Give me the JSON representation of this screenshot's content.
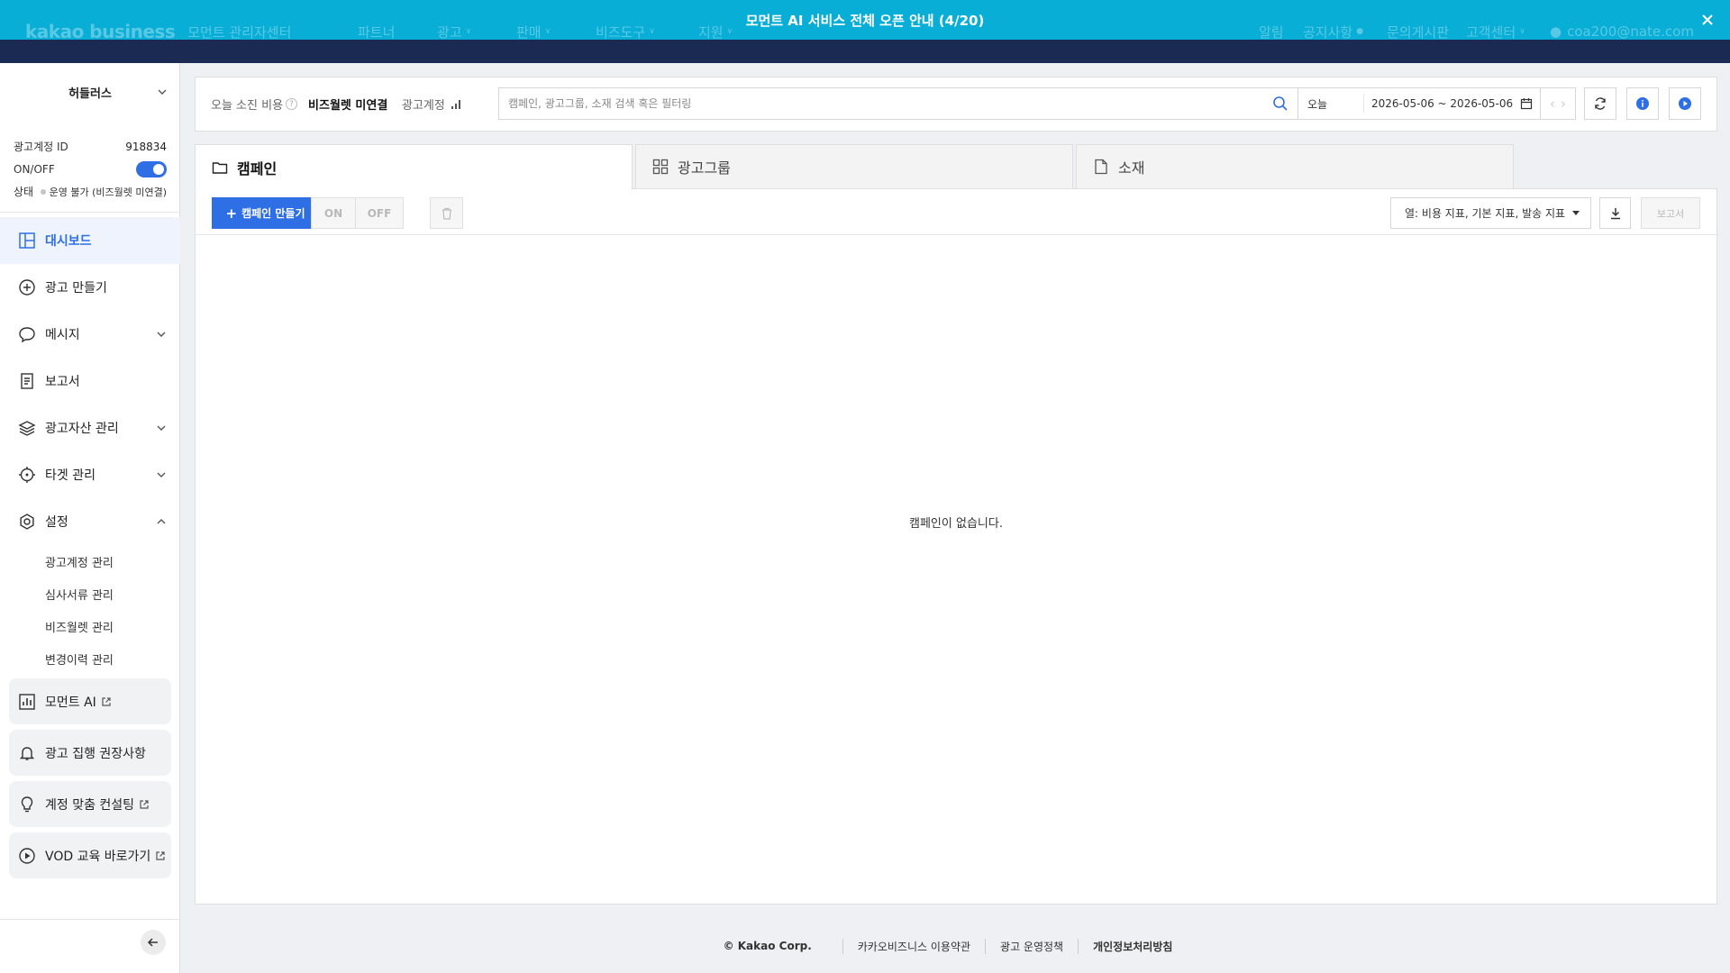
{
  "gnb": {
    "logo": "kakao business",
    "sub_title": "모먼트 관리자센터",
    "nav": [
      "파트너",
      "광고",
      "판매",
      "비즈도구",
      "지원"
    ],
    "right": [
      "알림",
      "공지사항",
      "문의게시판",
      "고객센터"
    ],
    "user": "coa200@nate.com",
    "banner": "모먼트 AI 서비스 전체 오픈 안내 (4/20)"
  },
  "sidebar": {
    "account_name": "허들러스",
    "info": {
      "id_label": "광고계정 ID",
      "id_value": "918834",
      "onoff_label": "ON/OFF",
      "state_label": "상태",
      "state_value": "운영 불가 (비즈월렛 미연결)"
    },
    "menu": [
      {
        "label": "대시보드"
      },
      {
        "label": "광고 만들기"
      },
      {
        "label": "메시지"
      },
      {
        "label": "보고서"
      },
      {
        "label": "광고자산 관리"
      },
      {
        "label": "타겟 관리"
      },
      {
        "label": "설정"
      }
    ],
    "submenu": [
      "광고계정 관리",
      "심사서류 관리",
      "비즈월렛 관리",
      "변경이력 관리"
    ],
    "cards": [
      "모먼트 AI",
      "광고 집행 권장사항",
      "계정 맞춤 컨설팅",
      "VOD 교육 바로가기"
    ]
  },
  "topbar": {
    "spend_label": "오늘 소진 비용",
    "spend_value": "비즈월렛 미연결",
    "account_label": "광고계정",
    "search_placeholder": "캠페인, 광고그룹, 소재 검색 혹은 필터링",
    "period": "오늘",
    "date_range": "2026-05-06 ~ 2026-05-06"
  },
  "tabs": [
    "캠페인",
    "광고그룹",
    "소재"
  ],
  "toolbar": {
    "create_label": "캠페인 만들기",
    "on_label": "ON",
    "off_label": "OFF",
    "columns_label": "열: 비용 지표, 기본 지표, 발송 지표",
    "report_label": "보고서"
  },
  "empty_message": "캠페인이 없습니다.",
  "footer": {
    "copyright": "© Kakao Corp.",
    "links": [
      "카카오비즈니스 이용약관",
      "광고 운영정책",
      "개인정보처리방침"
    ]
  },
  "colors": {
    "banner": "#09aed7",
    "dark_bar": "#1b2a52",
    "accent": "#2f6fe6"
  }
}
